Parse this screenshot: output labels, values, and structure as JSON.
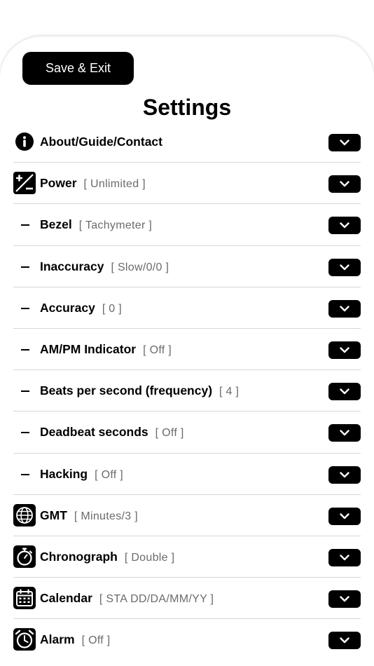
{
  "header": {
    "save_label": "Save & Exit",
    "title": "Settings"
  },
  "settings": [
    {
      "icon": "info-icon",
      "label": "About/Guide/Contact",
      "value": ""
    },
    {
      "icon": "plus-minus-icon",
      "label": "Power",
      "value": "[ Unlimited ]"
    },
    {
      "icon": "dash",
      "label": "Bezel",
      "value": "[ Tachymeter ]"
    },
    {
      "icon": "dash",
      "label": "Inaccuracy",
      "value": "[ Slow/0/0 ]"
    },
    {
      "icon": "dash",
      "label": "Accuracy",
      "value": "[ 0 ]"
    },
    {
      "icon": "dash",
      "label": "AM/PM Indicator",
      "value": "[ Off ]"
    },
    {
      "icon": "dash",
      "label": "Beats per second (frequency)",
      "value": "[ 4 ]"
    },
    {
      "icon": "dash",
      "label": "Deadbeat seconds",
      "value": "[ Off ]"
    },
    {
      "icon": "dash",
      "label": "Hacking",
      "value": "[ Off ]"
    },
    {
      "icon": "globe-icon",
      "label": "GMT",
      "value": "[ Minutes/3 ]"
    },
    {
      "icon": "stopwatch-icon",
      "label": "Chronograph",
      "value": "[ Double ]"
    },
    {
      "icon": "calendar-icon",
      "label": "Calendar",
      "value": "[ STA DD/DA/MM/YY ]"
    },
    {
      "icon": "alarm-clock-icon",
      "label": "Alarm",
      "value": "[ Off ]"
    }
  ],
  "colors": {
    "accent": "#000000",
    "value_text": "#6b6b6b",
    "divider": "#d6d6d6",
    "background": "#ffffff"
  }
}
